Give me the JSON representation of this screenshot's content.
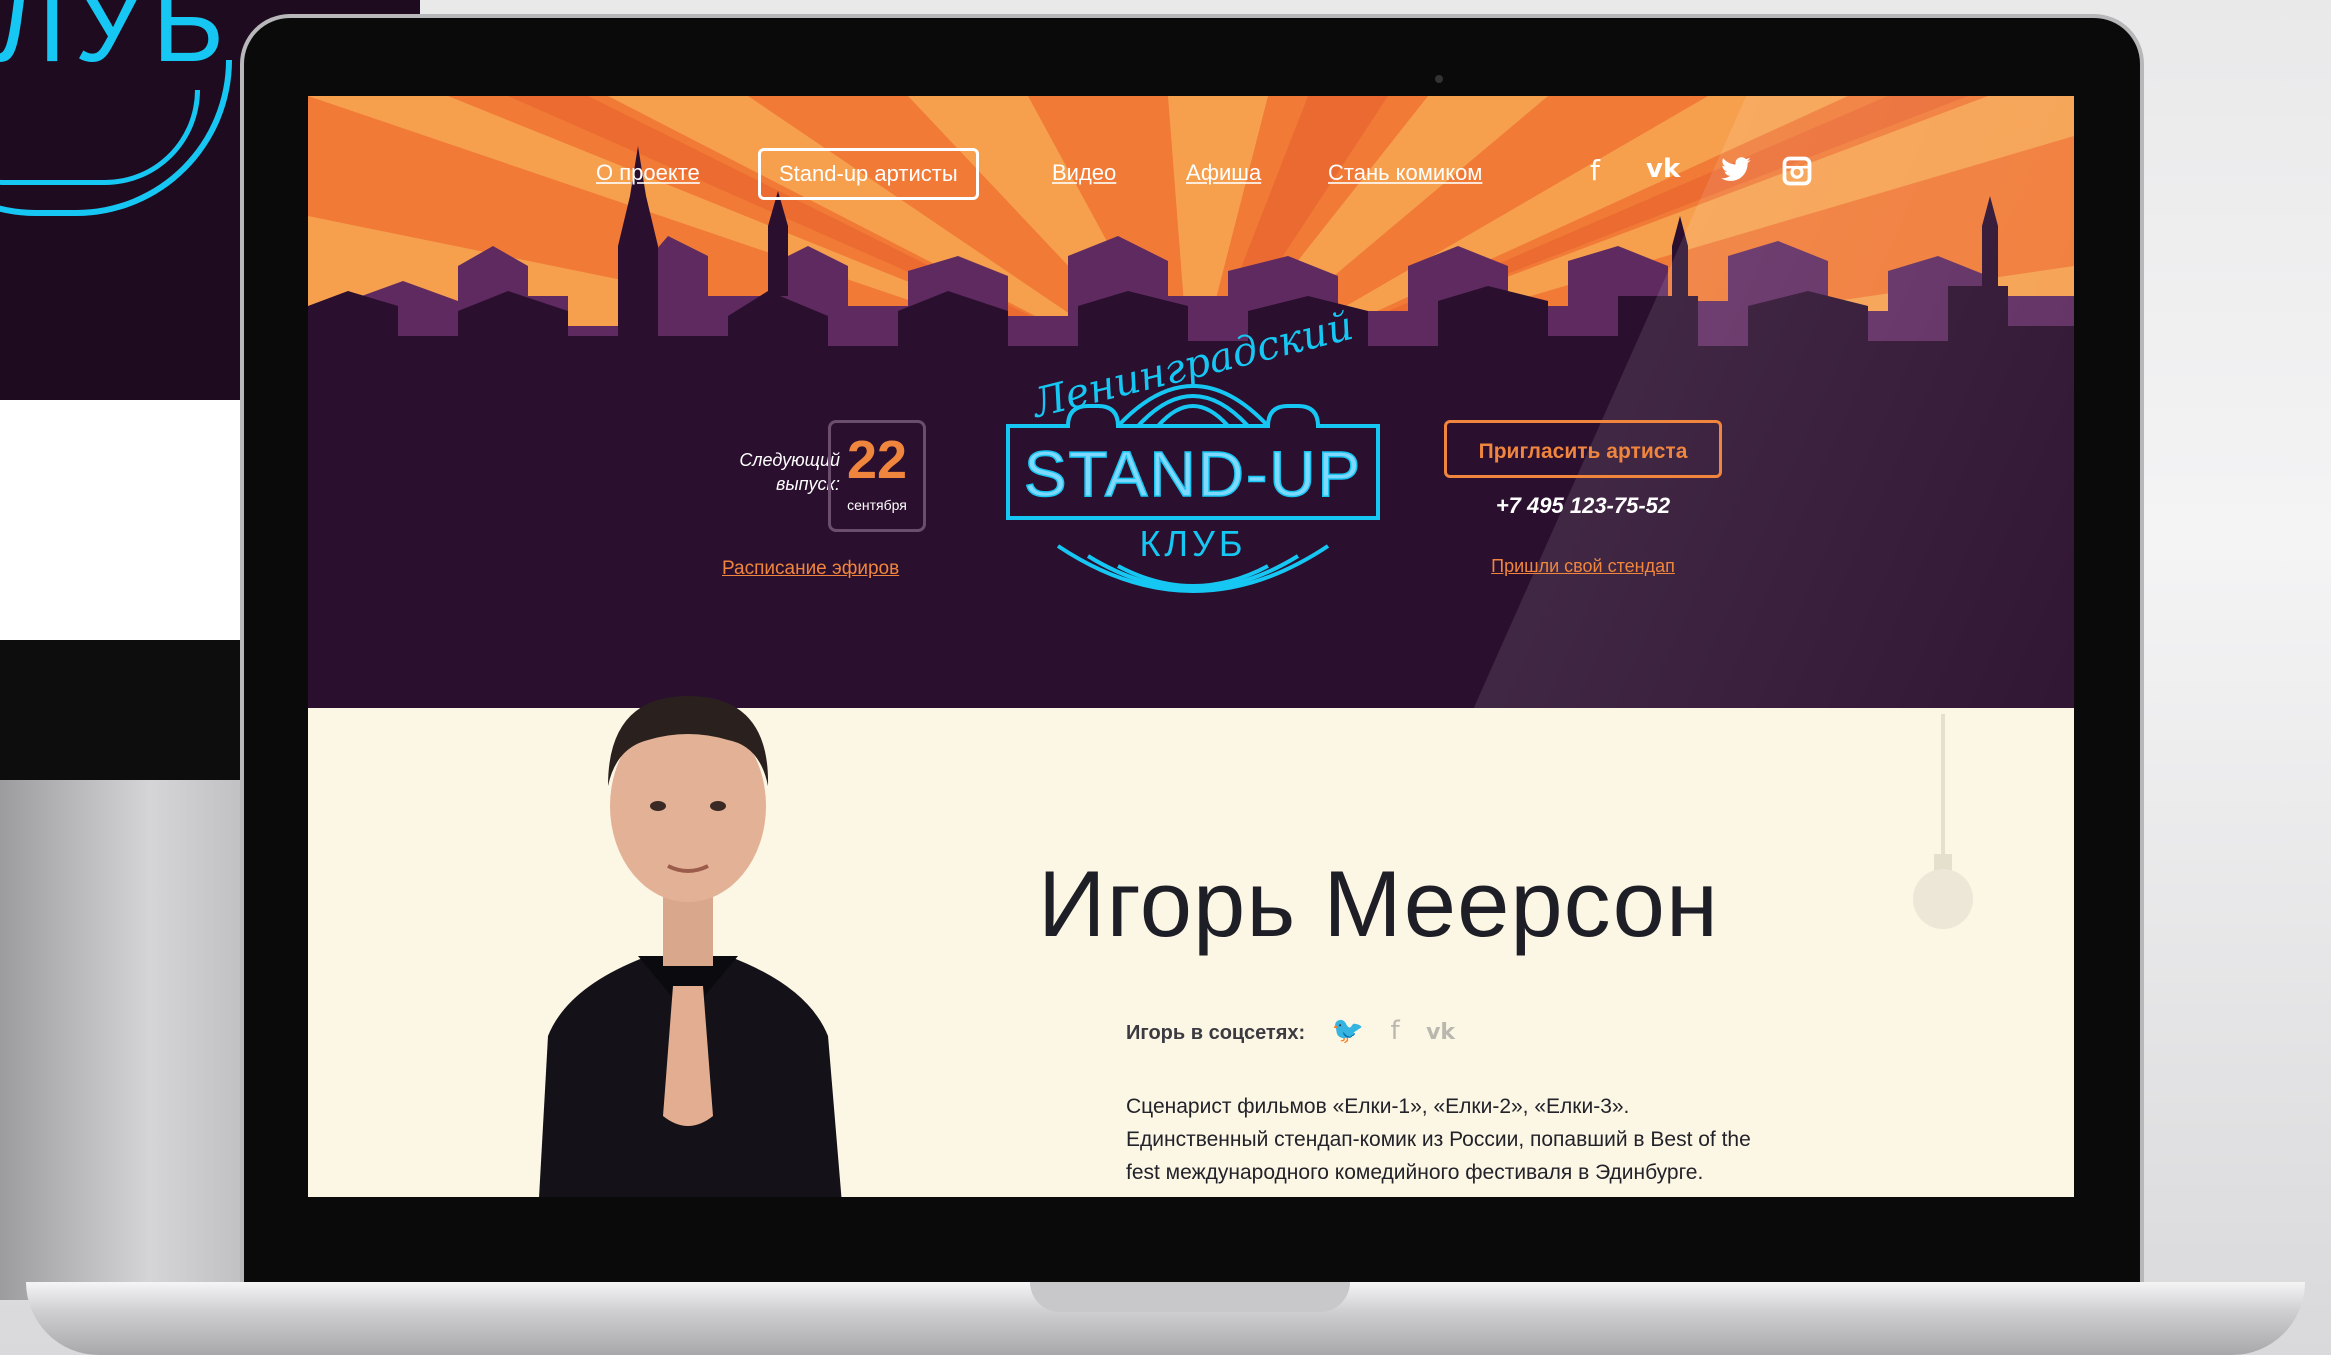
{
  "background_device": {
    "text": "ЛУБ"
  },
  "nav": {
    "items": [
      {
        "label": "О проекте"
      },
      {
        "label": "Stand-up артисты"
      },
      {
        "label": "Видео"
      },
      {
        "label": "Афиша"
      },
      {
        "label": "Стань комиком"
      }
    ],
    "social_icons": [
      "facebook-icon",
      "vk-icon",
      "twitter-icon",
      "instagram-icon"
    ],
    "social_glyphs": {
      "facebook": "f",
      "vk": "vk",
      "twitter": "🐦",
      "instagram": "◘"
    }
  },
  "next_episode": {
    "label_line1": "Следующий",
    "label_line2": "выпуск:",
    "day": "22",
    "month": "сентября",
    "schedule_link": "Расписание эфиров"
  },
  "logo": {
    "script": "Ленинградский",
    "main": "STAND-UP",
    "sub": "КЛУБ"
  },
  "contact": {
    "invite_button": "Пригласить артиста",
    "phone": "+7 495 123-75-52",
    "send_link": "Пришли свой стендап"
  },
  "artist": {
    "name": "Игорь Меерсон",
    "social_label": "Игорь в соцсетях:",
    "bio_lines": [
      "Сценарист фильмов «Елки-1», «Елки-2», «Елки-3».",
      "Единственный стендап-комик из России, попавший в Best of the",
      "fest международного комедийного фестиваля в Эдинбурге."
    ]
  },
  "colors": {
    "accent_orange": "#f0863d",
    "hero_purple": "#2b0f2e",
    "neon_blue": "#16c7f3",
    "cream": "#fcf6e4"
  }
}
